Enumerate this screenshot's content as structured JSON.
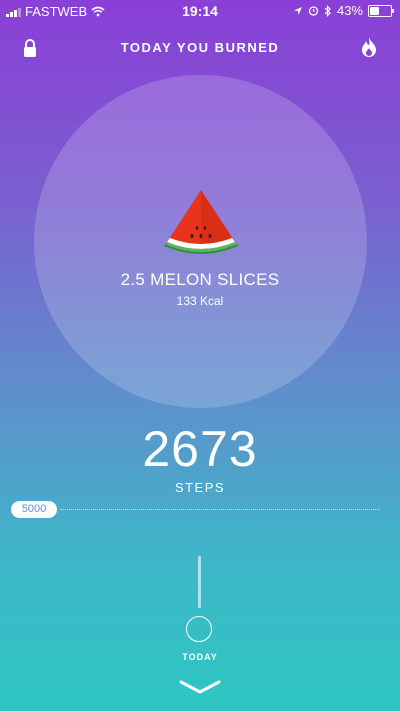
{
  "status_bar": {
    "carrier": "FASTWEB",
    "time": "19:14",
    "battery": "43%"
  },
  "header": {
    "title": "TODAY YOU BURNED"
  },
  "burned": {
    "item_title": "2.5 MELON SLICES",
    "kcal": "133 Kcal",
    "icon": "watermelon-icon"
  },
  "steps": {
    "value": "2673",
    "label": "STEPS",
    "goal": "5000"
  },
  "timeline": {
    "today_label": "TODAY"
  },
  "colors": {
    "gradient_top": "#8a3fd6",
    "gradient_bottom": "#2ec6c2"
  }
}
